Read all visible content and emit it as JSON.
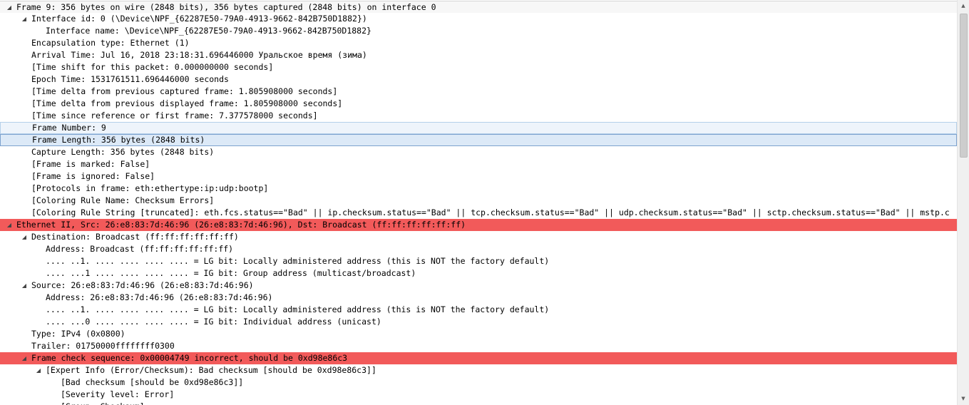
{
  "colors": {
    "error_row": "#f25a5a",
    "selected_row": "#dce9f7",
    "hover_row": "#eef4fb",
    "scrollbar_track": "#f0f0f0",
    "scrollbar_thumb": "#cdcdcd"
  },
  "icons": {
    "expanded": "tree-expanded-icon",
    "collapsed": "tree-collapsed-icon",
    "scroll_up": "scroll-up-arrow-icon",
    "scroll_down": "scroll-down-arrow-icon"
  },
  "glyphs": {
    "expanded": "◢",
    "scroll_up": "▲",
    "scroll_down": "▼"
  },
  "rows": [
    {
      "level": 0,
      "toggle": "expanded",
      "style": "first",
      "text": "Frame 9: 356 bytes on wire (2848 bits), 356 bytes captured (2848 bits) on interface 0"
    },
    {
      "level": 1,
      "toggle": "expanded",
      "text": "Interface id: 0 (\\Device\\NPF_{62287E50-79A0-4913-9662-842B750D1882})"
    },
    {
      "level": 2,
      "text": "Interface name: \\Device\\NPF_{62287E50-79A0-4913-9662-842B750D1882}"
    },
    {
      "level": 1,
      "text": "Encapsulation type: Ethernet (1)"
    },
    {
      "level": 1,
      "text": "Arrival Time: Jul 16, 2018 23:18:31.696446000 Уральское время (зима)"
    },
    {
      "level": 1,
      "text": "[Time shift for this packet: 0.000000000 seconds]"
    },
    {
      "level": 1,
      "text": "Epoch Time: 1531761511.696446000 seconds"
    },
    {
      "level": 1,
      "text": "[Time delta from previous captured frame: 1.805908000 seconds]"
    },
    {
      "level": 1,
      "text": "[Time delta from previous displayed frame: 1.805908000 seconds]"
    },
    {
      "level": 1,
      "text": "[Time since reference or first frame: 7.377578000 seconds]"
    },
    {
      "level": 1,
      "style": "sel",
      "text": "Frame Number: 9"
    },
    {
      "level": 1,
      "style": "sel2",
      "text": "Frame Length: 356 bytes (2848 bits)"
    },
    {
      "level": 1,
      "text": "Capture Length: 356 bytes (2848 bits)"
    },
    {
      "level": 1,
      "text": "[Frame is marked: False]"
    },
    {
      "level": 1,
      "text": "[Frame is ignored: False]"
    },
    {
      "level": 1,
      "text": "[Protocols in frame: eth:ethertype:ip:udp:bootp]"
    },
    {
      "level": 1,
      "text": "[Coloring Rule Name: Checksum Errors]"
    },
    {
      "level": 1,
      "text": "[Coloring Rule String [truncated]: eth.fcs.status==\"Bad\" || ip.checksum.status==\"Bad\" || tcp.checksum.status==\"Bad\" || udp.checksum.status==\"Bad\" || sctp.checksum.status==\"Bad\" || mstp.c"
    },
    {
      "level": 0,
      "toggle": "expanded",
      "style": "error",
      "text": "Ethernet II, Src: 26:e8:83:7d:46:96 (26:e8:83:7d:46:96), Dst: Broadcast (ff:ff:ff:ff:ff:ff)"
    },
    {
      "level": 1,
      "toggle": "expanded",
      "text": "Destination: Broadcast (ff:ff:ff:ff:ff:ff)"
    },
    {
      "level": 2,
      "text": "Address: Broadcast (ff:ff:ff:ff:ff:ff)"
    },
    {
      "level": 2,
      "text": ".... ..1. .... .... .... .... = LG bit: Locally administered address (this is NOT the factory default)"
    },
    {
      "level": 2,
      "text": ".... ...1 .... .... .... .... = IG bit: Group address (multicast/broadcast)"
    },
    {
      "level": 1,
      "toggle": "expanded",
      "text": "Source: 26:e8:83:7d:46:96 (26:e8:83:7d:46:96)"
    },
    {
      "level": 2,
      "text": "Address: 26:e8:83:7d:46:96 (26:e8:83:7d:46:96)"
    },
    {
      "level": 2,
      "text": ".... ..1. .... .... .... .... = LG bit: Locally administered address (this is NOT the factory default)"
    },
    {
      "level": 2,
      "text": ".... ...0 .... .... .... .... = IG bit: Individual address (unicast)"
    },
    {
      "level": 1,
      "text": "Type: IPv4 (0x0800)"
    },
    {
      "level": 1,
      "text": "Trailer: 01750000ffffffff0300"
    },
    {
      "level": 1,
      "toggle": "expanded",
      "style": "error",
      "text": "Frame check sequence: 0x00004749 incorrect, should be 0xd98e86c3"
    },
    {
      "level": 2,
      "toggle": "expanded",
      "text": "[Expert Info (Error/Checksum): Bad checksum [should be 0xd98e86c3]]"
    },
    {
      "level": 3,
      "text": "[Bad checksum [should be 0xd98e86c3]]"
    },
    {
      "level": 3,
      "text": "[Severity level: Error]"
    },
    {
      "level": 3,
      "text": "[Group: Checksum]"
    }
  ]
}
